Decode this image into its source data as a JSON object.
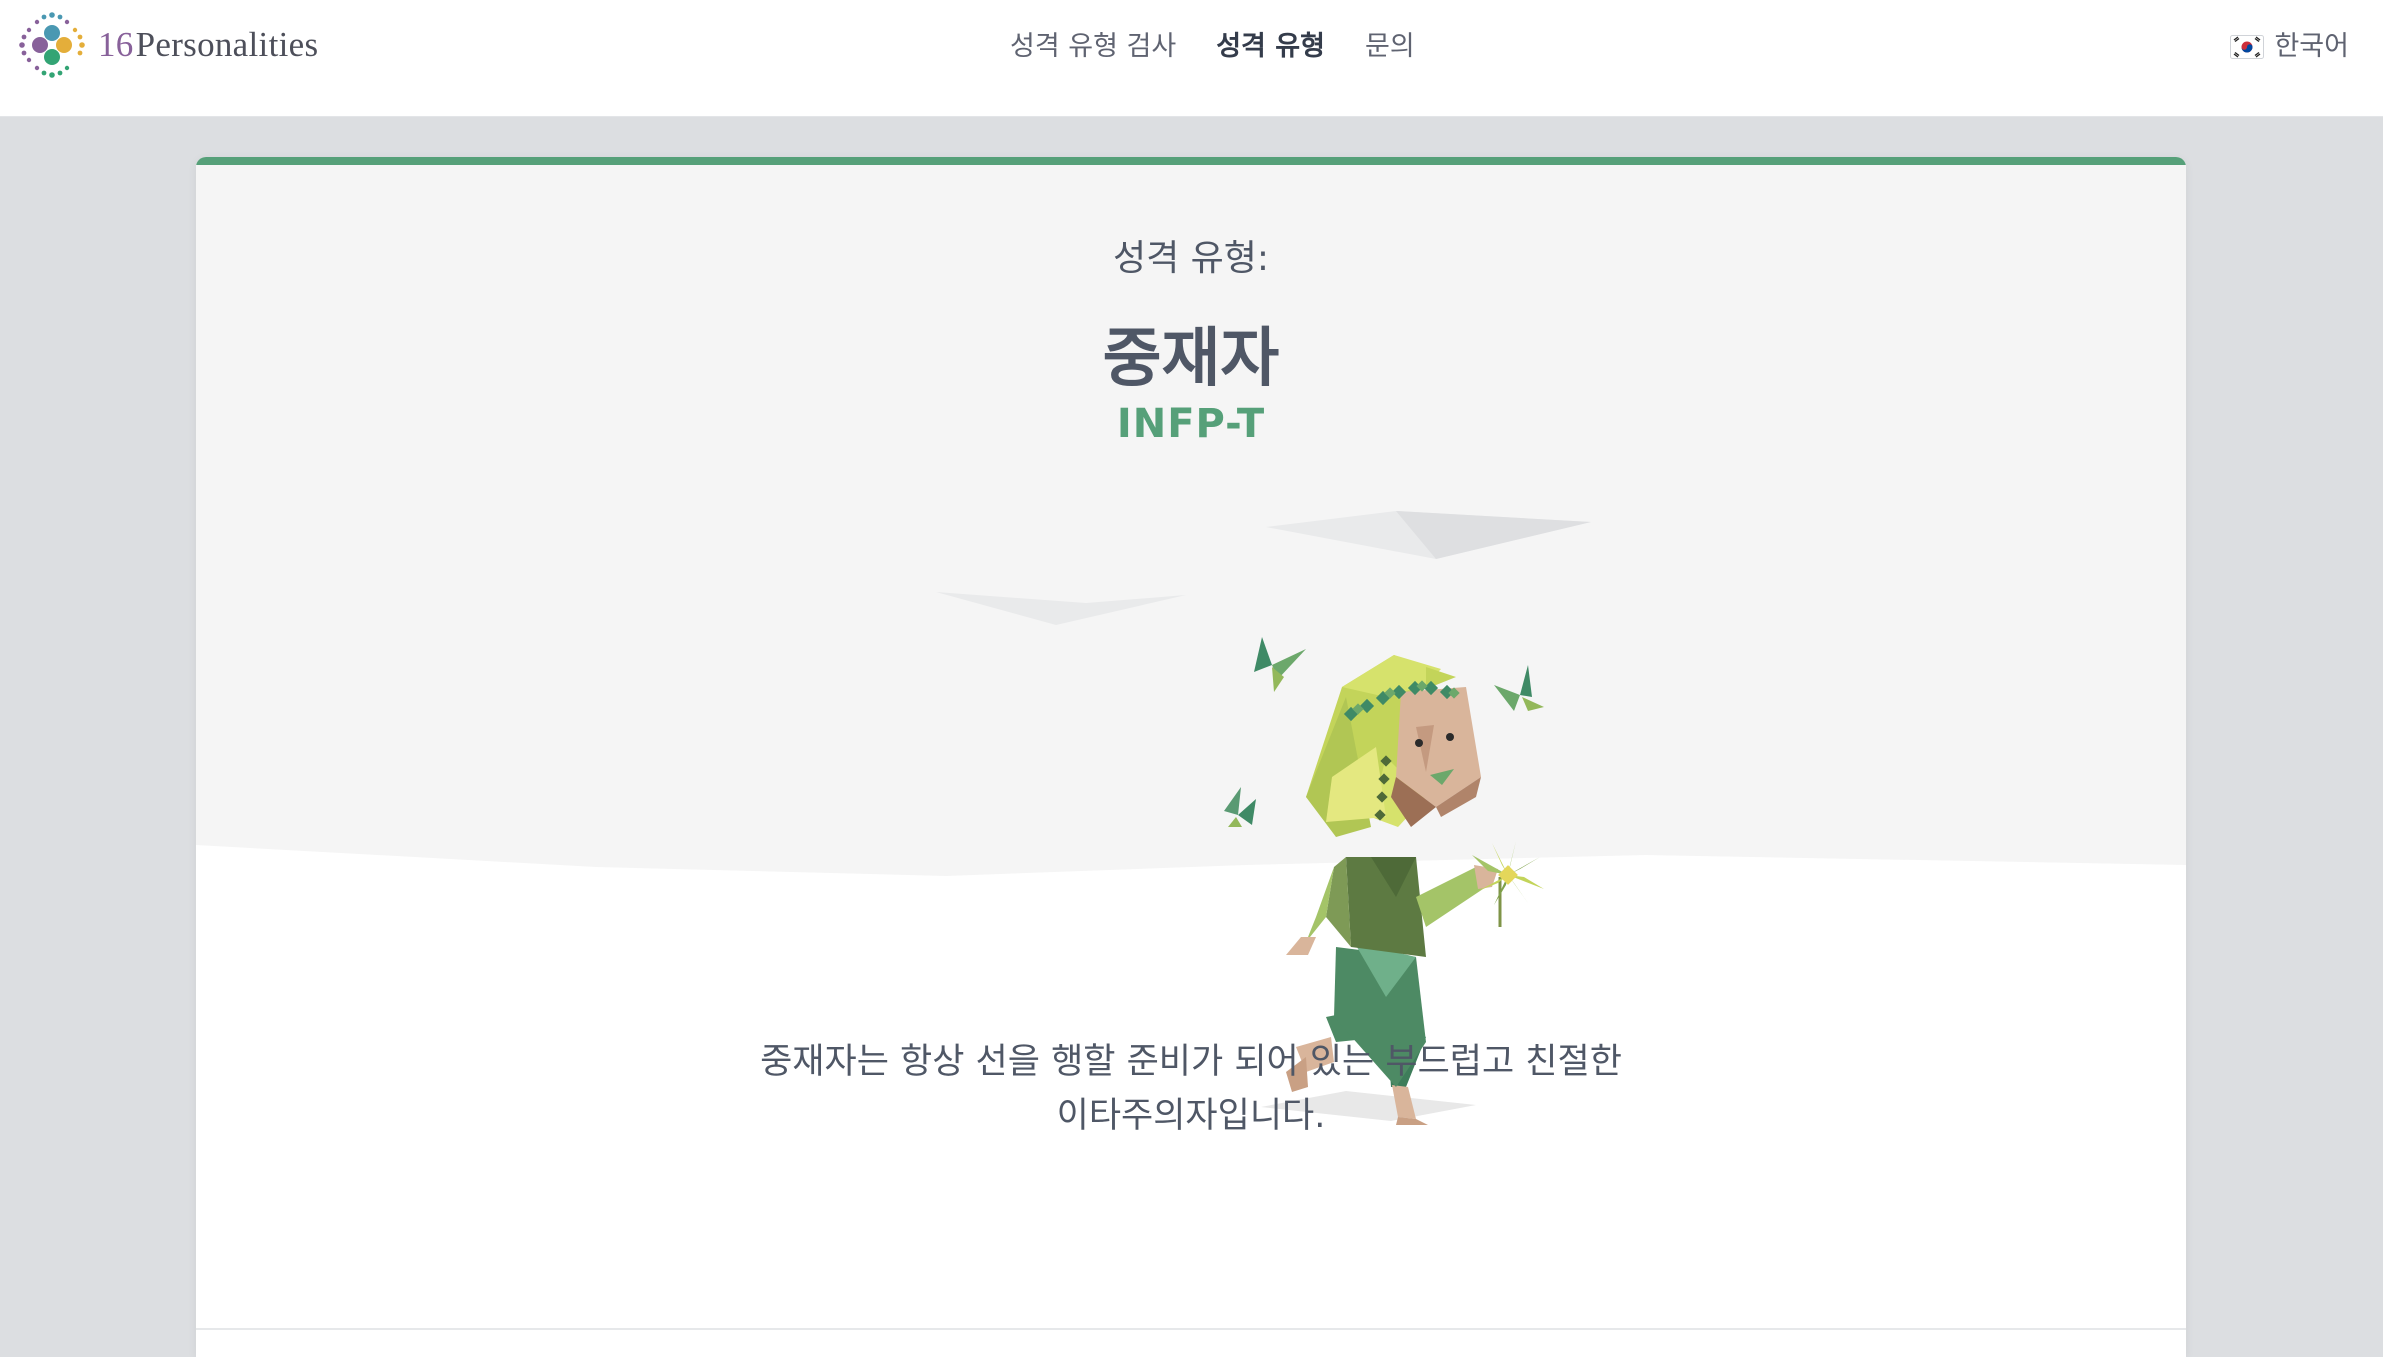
{
  "header": {
    "logo": {
      "number": "16",
      "name": "Personalities"
    },
    "nav": [
      {
        "label": "성격 유형 검사",
        "active": false
      },
      {
        "label": "성격 유형",
        "active": true
      },
      {
        "label": "문의",
        "active": false
      }
    ],
    "language": {
      "flag_icon": "korea-flag-icon",
      "label": "한국어"
    }
  },
  "card": {
    "accent_color": "#56a079",
    "kicker": "성격 유형:",
    "type_name": "중재자",
    "type_code": "INFP-T",
    "illustration_icon": "mediator-character-illustration",
    "description_line1": "중재자는 항상 선을 행할 준비가 되어 있는 부드럽고 친절한",
    "description_line2": "이타주의자입니다."
  }
}
